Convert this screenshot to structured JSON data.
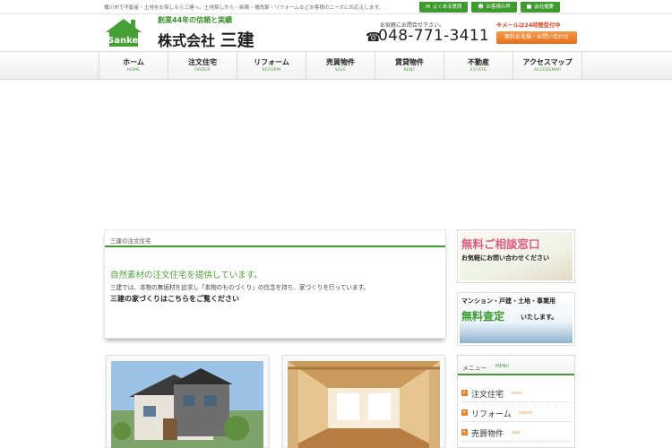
{
  "header": {
    "tagline": "桶川市で不動産・土地をお探しなら三建へ。土地探しから・新築・増改築・リフォームなどお客様のニーズにお応えします。",
    "top_links": [
      {
        "label": "よくある質問",
        "icon": "chat-icon"
      },
      {
        "label": "お客様の声",
        "icon": "people-icon"
      },
      {
        "label": "会社概要",
        "icon": "building-icon"
      }
    ],
    "logo": {
      "slogan": "創業44年の信頼と実績",
      "company_prefix": "株式会社",
      "company_name": "三建",
      "mark_text": "Sanken"
    },
    "contact": {
      "note": "お気軽にお問合せ下さい。",
      "phone": "048-771-3411",
      "mail_note": "※メールは24時間受付中",
      "mail_button": "無料お見積・お問い合わせ"
    }
  },
  "nav": [
    {
      "jp": "ホーム",
      "en": "HOME"
    },
    {
      "jp": "注文住宅",
      "en": "ORDER"
    },
    {
      "jp": "リフォーム",
      "en": "REFORM"
    },
    {
      "jp": "売買物件",
      "en": "SALE"
    },
    {
      "jp": "賃貸物件",
      "en": "RENT"
    },
    {
      "jp": "不動産",
      "en": "ESTATE"
    },
    {
      "jp": "アクセスマップ",
      "en": "ACCESSMAP"
    }
  ],
  "about": {
    "heading": "三建の注文住宅",
    "title": "自然素材の注文住宅を提供しています。",
    "body": "三建では、本物の無垢材を追求し「本物のものづくり」の信念を持ち、家づくりを行っています。",
    "link": "三建の家づくりはこちらをご覧ください"
  },
  "sidebar": {
    "banner1": {
      "title": "無料ご相談窓口",
      "sub": "お気軽にお問い合わせください"
    },
    "banner2": {
      "top": "マンション・戸建・土地・事業用",
      "main": "無料査定",
      "tail": "いたします。"
    },
    "menu": {
      "heading": "メニュー",
      "heading_en": "MENU",
      "items": [
        {
          "jp": "注文住宅",
          "en": "order"
        },
        {
          "jp": "リフォーム",
          "en": "reform"
        },
        {
          "jp": "売買物件",
          "en": "sale"
        }
      ]
    }
  }
}
